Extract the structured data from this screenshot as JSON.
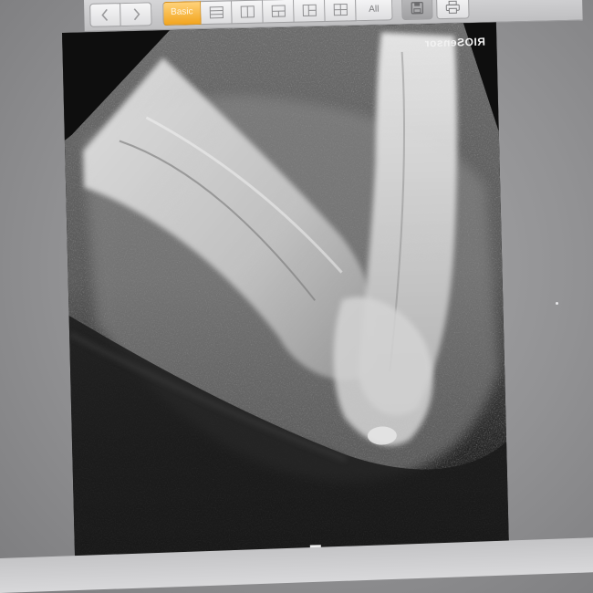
{
  "toolbar": {
    "back_icon": "chevron-left-icon",
    "forward_icon": "chevron-right-icon",
    "layouts": [
      {
        "name": "basic",
        "label": "Basic",
        "active": true
      },
      {
        "name": "layout-1x2",
        "icon": "layout-rows-icon"
      },
      {
        "name": "layout-2x1",
        "icon": "layout-columns-icon"
      },
      {
        "name": "layout-2x2",
        "icon": "layout-grid-icon"
      },
      {
        "name": "layout-split",
        "icon": "layout-split-icon"
      },
      {
        "name": "layout-quad",
        "icon": "layout-quad-icon"
      },
      {
        "name": "all",
        "label": "All"
      }
    ],
    "save_icon": "save-icon",
    "print_icon": "printer-icon",
    "accent_color": "#f2a51f"
  },
  "viewer": {
    "brand_label": "RIOSensor",
    "orientation_marker": "H",
    "image_description_icon": "dental-xray-image"
  }
}
